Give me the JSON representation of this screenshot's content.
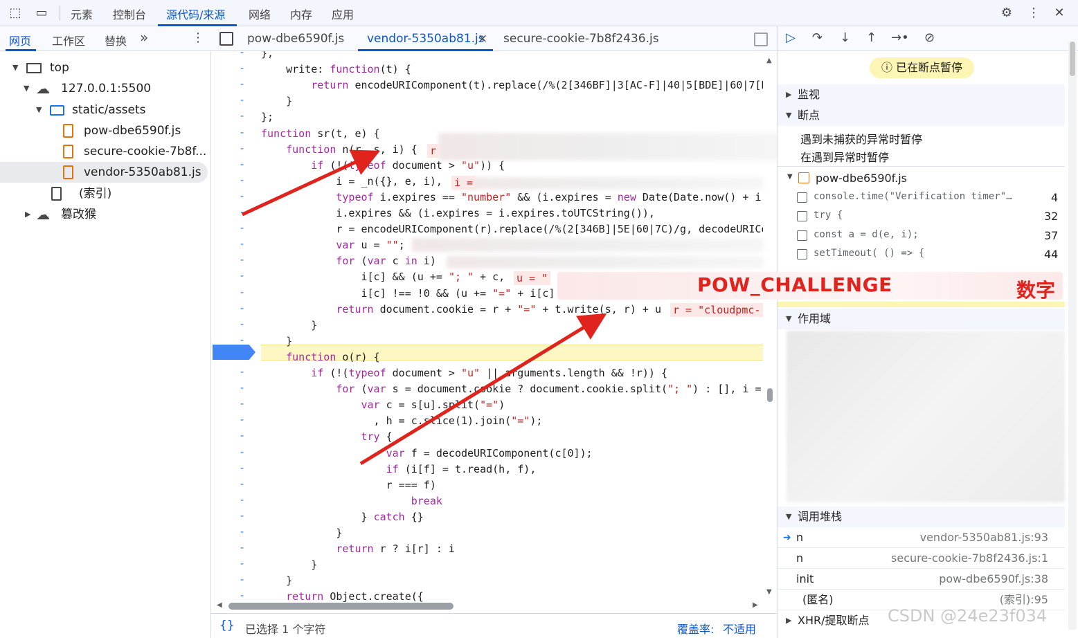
{
  "topbar": {
    "tabs": [
      "元素",
      "控制台",
      "源代码/来源",
      "网络",
      "内存",
      "应用"
    ],
    "active_tab": "源代码/来源",
    "icons": [
      "inspect-icon",
      "device-toggle-icon",
      "gear-icon",
      "more-vert-icon",
      "close-icon"
    ]
  },
  "left_panel": {
    "tabs": [
      "网页",
      "工作区",
      "替换"
    ],
    "more": "»",
    "tree": [
      {
        "label": "top",
        "icon": "frame-icon"
      },
      {
        "label": "127.0.0.1:5500",
        "icon": "cloud-icon"
      },
      {
        "label": "static/assets",
        "icon": "folder-icon"
      },
      {
        "label": "pow-dbe6590f.js",
        "icon": "js-file-icon"
      },
      {
        "label": "secure-cookie-7b8f...",
        "icon": "js-file-icon"
      },
      {
        "label": "vendor-5350ab81.js",
        "icon": "js-file-icon"
      },
      {
        "label": "(索引)",
        "icon": "file-icon"
      },
      {
        "label": "篡改猴",
        "icon": "cloud-icon"
      }
    ]
  },
  "editor": {
    "tabs": [
      "pow-dbe6590f.js",
      "vendor-5350ab81.js",
      "secure-cookie-7b8f2436.js"
    ],
    "active_tab": "vendor-5350ab81.js",
    "close_glyph": "×",
    "code_lines": [
      "},",
      "    write: function(t) {",
      "        return encodeURIComponent(t).replace(/%(2[346BF]|3[AC-F]|40|5[BDE]|60|7[B",
      "    }",
      "};",
      "function sr(t, e) {",
      "    function n(r, s, i) {  r",
      "        if (!(typeof document > \"u\")) {",
      "            i = _n({}, e, i),  i =",
      "            typeof i.expires == \"number\" && (i.expires = new Date(Date.now() + i.",
      "            i.expires && (i.expires = i.expires.toUTCString()),",
      "            r = encodeURIComponent(r).replace(/%(2[346B]|5E|60|7C)/g, decodeURICo",
      "            var u = \"\";",
      "            for (var c in i)",
      "                i[c] && (u += \"; \" + c,  u = \"",
      "                i[c] !== !0 && (u += \"=\" + i[c]",
      "            return document.cookie = r + \"=\" + t.write(s, r) + u  r = \"cloudpmc-",
      "        }",
      "    }",
      "    function o(r) {",
      "        if (!(typeof document > \"u\" || arguments.length && !r)) {",
      "            for (var s = document.cookie ? document.cookie.split(\"; \") : [], i =",
      "                var c = s[u].split(\"=\")",
      "                  , h = c.slice(1).join(\"=\");",
      "                try {",
      "                    var f = decodeURIComponent(c[0]);",
      "                    if (i[f] = t.read(h, f),",
      "                    r === f)",
      "                        break",
      "                } catch {}",
      "            }",
      "            return r ? i[r] : i",
      "        }",
      "    }",
      "    return Object.create({"
    ],
    "inline_values": [
      "r",
      "i =",
      "u = \"",
      "r = \"cloudpmc-"
    ],
    "paused_line_marker": "-",
    "status_left": "已选择 1 个字符",
    "status_right_label": "覆盖率:",
    "status_right_value": "不适用"
  },
  "right_panel": {
    "paused_label": "已在断点暂停",
    "sections": {
      "watch": "监视",
      "breakpoints": "断点",
      "scope": "作用域",
      "callstack": "调用堆栈",
      "xhr": "XHR/提取断点"
    },
    "exception_options": [
      "遇到未捕获的异常时暂停",
      "在遇到异常时暂停"
    ],
    "bp_file": "pow-dbe6590f.js",
    "breakpoints": [
      {
        "code": "console.time(\"Verification timer\"…",
        "line": "4"
      },
      {
        "code": "try {",
        "line": "32"
      },
      {
        "code": "const a = d(e, i);",
        "line": "37"
      },
      {
        "code": "setTimeout( () => {",
        "line": "44"
      }
    ],
    "call_stack": [
      {
        "fn": "n",
        "loc": "vendor-5350ab81.js:93",
        "current": true
      },
      {
        "fn": "n",
        "loc": "secure-cookie-7b8f2436.js:1",
        "current": false
      },
      {
        "fn": "init",
        "loc": "pow-dbe6590f.js:38",
        "current": false
      },
      {
        "fn": "(匿名)",
        "loc": "(索引):95",
        "current": false
      }
    ]
  },
  "annotation": {
    "pow_label": "POW_CHALLENGE",
    "num_label": "数字",
    "arrow_color": "#e0231c"
  },
  "watermark": "CSDN @24e23f034"
}
